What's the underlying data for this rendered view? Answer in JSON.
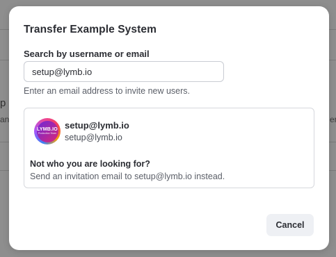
{
  "background": {
    "left_title_fragment": "p",
    "left_sub_fragment": "anc",
    "right_sub_fragment": "er"
  },
  "modal": {
    "title": "Transfer Example System",
    "search": {
      "label": "Search by username or email",
      "value": "setup@lymb.io",
      "helper": "Enter an email address to invite new users."
    },
    "result": {
      "avatar": {
        "logo_text": "LYMB.IO",
        "sub_text": "Production Team"
      },
      "user_name": "setup@lymb.io",
      "user_email": "setup@lymb.io",
      "not_found_title": "Not who you are looking for?",
      "invite_text": "Send an invitation email to setup@lymb.io instead."
    },
    "cancel_label": "Cancel"
  },
  "colors": {
    "overlay": "#8e8e8e",
    "modal_bg": "#ffffff",
    "button_bg": "#eef0f4",
    "text_primary": "#2b2d33",
    "text_secondary": "#5b5f68"
  }
}
